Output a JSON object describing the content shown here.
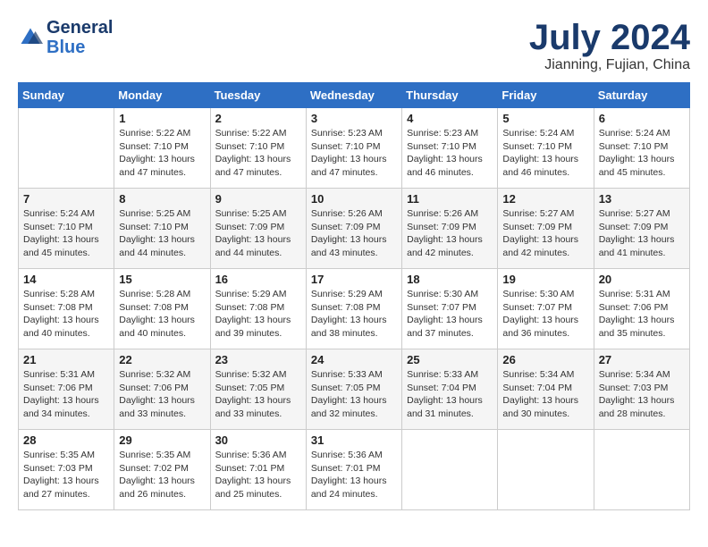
{
  "header": {
    "logo_general": "General",
    "logo_blue": "Blue",
    "month_title": "July 2024",
    "location": "Jianning, Fujian, China"
  },
  "days_of_week": [
    "Sunday",
    "Monday",
    "Tuesday",
    "Wednesday",
    "Thursday",
    "Friday",
    "Saturday"
  ],
  "weeks": [
    [
      {
        "day": "",
        "sunrise": "",
        "sunset": "",
        "daylight": ""
      },
      {
        "day": "1",
        "sunrise": "Sunrise: 5:22 AM",
        "sunset": "Sunset: 7:10 PM",
        "daylight": "Daylight: 13 hours and 47 minutes."
      },
      {
        "day": "2",
        "sunrise": "Sunrise: 5:22 AM",
        "sunset": "Sunset: 7:10 PM",
        "daylight": "Daylight: 13 hours and 47 minutes."
      },
      {
        "day": "3",
        "sunrise": "Sunrise: 5:23 AM",
        "sunset": "Sunset: 7:10 PM",
        "daylight": "Daylight: 13 hours and 47 minutes."
      },
      {
        "day": "4",
        "sunrise": "Sunrise: 5:23 AM",
        "sunset": "Sunset: 7:10 PM",
        "daylight": "Daylight: 13 hours and 46 minutes."
      },
      {
        "day": "5",
        "sunrise": "Sunrise: 5:24 AM",
        "sunset": "Sunset: 7:10 PM",
        "daylight": "Daylight: 13 hours and 46 minutes."
      },
      {
        "day": "6",
        "sunrise": "Sunrise: 5:24 AM",
        "sunset": "Sunset: 7:10 PM",
        "daylight": "Daylight: 13 hours and 45 minutes."
      }
    ],
    [
      {
        "day": "7",
        "sunrise": "Sunrise: 5:24 AM",
        "sunset": "Sunset: 7:10 PM",
        "daylight": "Daylight: 13 hours and 45 minutes."
      },
      {
        "day": "8",
        "sunrise": "Sunrise: 5:25 AM",
        "sunset": "Sunset: 7:10 PM",
        "daylight": "Daylight: 13 hours and 44 minutes."
      },
      {
        "day": "9",
        "sunrise": "Sunrise: 5:25 AM",
        "sunset": "Sunset: 7:09 PM",
        "daylight": "Daylight: 13 hours and 44 minutes."
      },
      {
        "day": "10",
        "sunrise": "Sunrise: 5:26 AM",
        "sunset": "Sunset: 7:09 PM",
        "daylight": "Daylight: 13 hours and 43 minutes."
      },
      {
        "day": "11",
        "sunrise": "Sunrise: 5:26 AM",
        "sunset": "Sunset: 7:09 PM",
        "daylight": "Daylight: 13 hours and 42 minutes."
      },
      {
        "day": "12",
        "sunrise": "Sunrise: 5:27 AM",
        "sunset": "Sunset: 7:09 PM",
        "daylight": "Daylight: 13 hours and 42 minutes."
      },
      {
        "day": "13",
        "sunrise": "Sunrise: 5:27 AM",
        "sunset": "Sunset: 7:09 PM",
        "daylight": "Daylight: 13 hours and 41 minutes."
      }
    ],
    [
      {
        "day": "14",
        "sunrise": "Sunrise: 5:28 AM",
        "sunset": "Sunset: 7:08 PM",
        "daylight": "Daylight: 13 hours and 40 minutes."
      },
      {
        "day": "15",
        "sunrise": "Sunrise: 5:28 AM",
        "sunset": "Sunset: 7:08 PM",
        "daylight": "Daylight: 13 hours and 40 minutes."
      },
      {
        "day": "16",
        "sunrise": "Sunrise: 5:29 AM",
        "sunset": "Sunset: 7:08 PM",
        "daylight": "Daylight: 13 hours and 39 minutes."
      },
      {
        "day": "17",
        "sunrise": "Sunrise: 5:29 AM",
        "sunset": "Sunset: 7:08 PM",
        "daylight": "Daylight: 13 hours and 38 minutes."
      },
      {
        "day": "18",
        "sunrise": "Sunrise: 5:30 AM",
        "sunset": "Sunset: 7:07 PM",
        "daylight": "Daylight: 13 hours and 37 minutes."
      },
      {
        "day": "19",
        "sunrise": "Sunrise: 5:30 AM",
        "sunset": "Sunset: 7:07 PM",
        "daylight": "Daylight: 13 hours and 36 minutes."
      },
      {
        "day": "20",
        "sunrise": "Sunrise: 5:31 AM",
        "sunset": "Sunset: 7:06 PM",
        "daylight": "Daylight: 13 hours and 35 minutes."
      }
    ],
    [
      {
        "day": "21",
        "sunrise": "Sunrise: 5:31 AM",
        "sunset": "Sunset: 7:06 PM",
        "daylight": "Daylight: 13 hours and 34 minutes."
      },
      {
        "day": "22",
        "sunrise": "Sunrise: 5:32 AM",
        "sunset": "Sunset: 7:06 PM",
        "daylight": "Daylight: 13 hours and 33 minutes."
      },
      {
        "day": "23",
        "sunrise": "Sunrise: 5:32 AM",
        "sunset": "Sunset: 7:05 PM",
        "daylight": "Daylight: 13 hours and 33 minutes."
      },
      {
        "day": "24",
        "sunrise": "Sunrise: 5:33 AM",
        "sunset": "Sunset: 7:05 PM",
        "daylight": "Daylight: 13 hours and 32 minutes."
      },
      {
        "day": "25",
        "sunrise": "Sunrise: 5:33 AM",
        "sunset": "Sunset: 7:04 PM",
        "daylight": "Daylight: 13 hours and 31 minutes."
      },
      {
        "day": "26",
        "sunrise": "Sunrise: 5:34 AM",
        "sunset": "Sunset: 7:04 PM",
        "daylight": "Daylight: 13 hours and 30 minutes."
      },
      {
        "day": "27",
        "sunrise": "Sunrise: 5:34 AM",
        "sunset": "Sunset: 7:03 PM",
        "daylight": "Daylight: 13 hours and 28 minutes."
      }
    ],
    [
      {
        "day": "28",
        "sunrise": "Sunrise: 5:35 AM",
        "sunset": "Sunset: 7:03 PM",
        "daylight": "Daylight: 13 hours and 27 minutes."
      },
      {
        "day": "29",
        "sunrise": "Sunrise: 5:35 AM",
        "sunset": "Sunset: 7:02 PM",
        "daylight": "Daylight: 13 hours and 26 minutes."
      },
      {
        "day": "30",
        "sunrise": "Sunrise: 5:36 AM",
        "sunset": "Sunset: 7:01 PM",
        "daylight": "Daylight: 13 hours and 25 minutes."
      },
      {
        "day": "31",
        "sunrise": "Sunrise: 5:36 AM",
        "sunset": "Sunset: 7:01 PM",
        "daylight": "Daylight: 13 hours and 24 minutes."
      },
      {
        "day": "",
        "sunrise": "",
        "sunset": "",
        "daylight": ""
      },
      {
        "day": "",
        "sunrise": "",
        "sunset": "",
        "daylight": ""
      },
      {
        "day": "",
        "sunrise": "",
        "sunset": "",
        "daylight": ""
      }
    ]
  ]
}
